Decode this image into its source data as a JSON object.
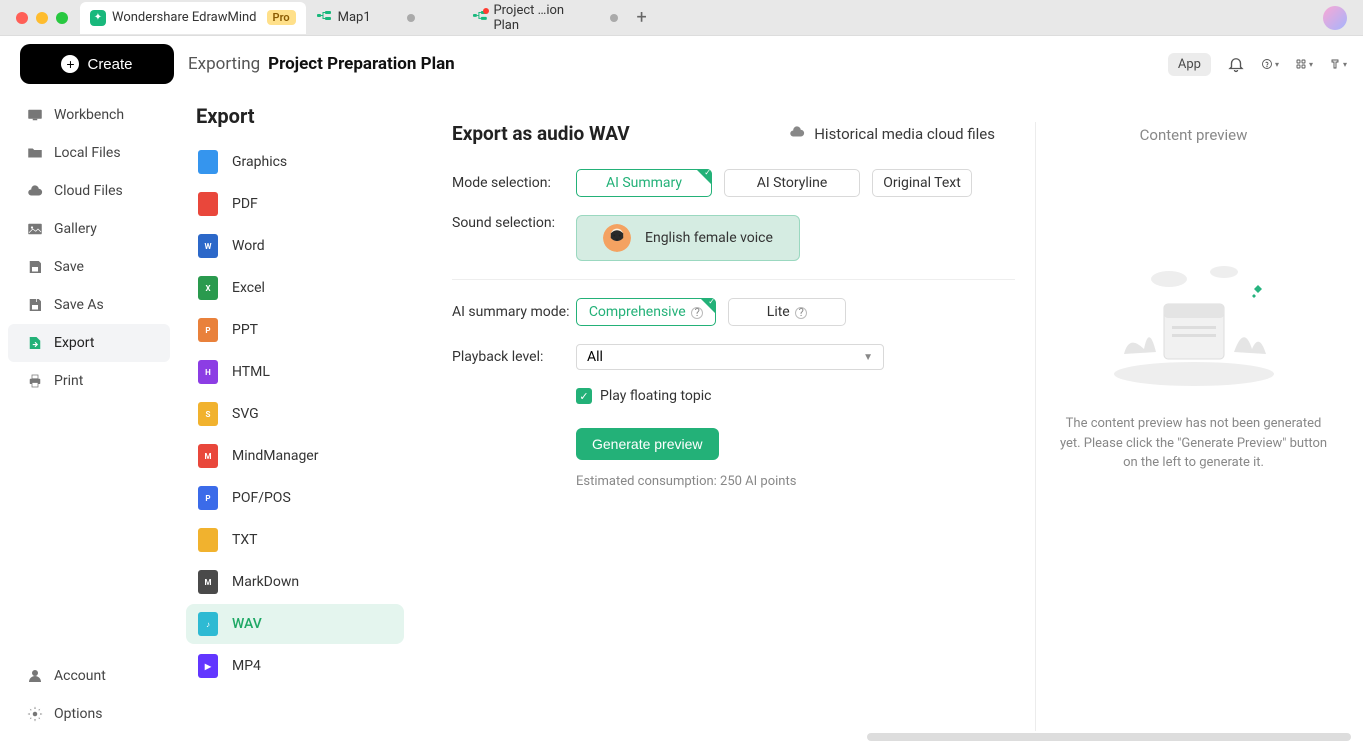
{
  "titlebar": {
    "app_name": "Wondershare EdrawMind",
    "pro_label": "Pro",
    "tabs": [
      {
        "label": "Map1"
      },
      {
        "label": "Project …ion Plan"
      }
    ]
  },
  "header": {
    "create_label": "Create",
    "breadcrumb_exporting": "Exporting",
    "breadcrumb_title": "Project Preparation Plan",
    "app_btn": "App"
  },
  "left_nav": {
    "items": [
      {
        "label": "Workbench",
        "icon": "workbench"
      },
      {
        "label": "Local Files",
        "icon": "folder"
      },
      {
        "label": "Cloud Files",
        "icon": "cloud"
      },
      {
        "label": "Gallery",
        "icon": "gallery"
      },
      {
        "label": "Save",
        "icon": "save"
      },
      {
        "label": "Save As",
        "icon": "save-as"
      },
      {
        "label": "Export",
        "icon": "export",
        "active": true
      },
      {
        "label": "Print",
        "icon": "print"
      }
    ],
    "bottom": [
      {
        "label": "Account",
        "icon": "account"
      },
      {
        "label": "Options",
        "icon": "gear"
      }
    ]
  },
  "export_panel": {
    "title": "Export",
    "formats": [
      {
        "label": "Graphics"
      },
      {
        "label": "PDF"
      },
      {
        "label": "Word"
      },
      {
        "label": "Excel"
      },
      {
        "label": "PPT"
      },
      {
        "label": "HTML"
      },
      {
        "label": "SVG"
      },
      {
        "label": "MindManager"
      },
      {
        "label": "POF/POS"
      },
      {
        "label": "TXT"
      },
      {
        "label": "MarkDown"
      },
      {
        "label": "WAV",
        "active": true
      },
      {
        "label": "MP4"
      }
    ]
  },
  "form": {
    "title": "Export as audio WAV",
    "cloud_link": "Historical media cloud files",
    "mode_label": "Mode selection:",
    "modes": [
      {
        "label": "AI Summary",
        "selected": true
      },
      {
        "label": "AI Storyline"
      },
      {
        "label": "Original Text"
      }
    ],
    "sound_label": "Sound selection:",
    "voice_label": "English female voice",
    "ai_mode_label": "AI summary mode:",
    "ai_modes": [
      {
        "label": "Comprehensive",
        "selected": true
      },
      {
        "label": "Lite"
      }
    ],
    "playback_label": "Playback level:",
    "playback_value": "All",
    "floating_label": "Play floating topic",
    "generate_btn": "Generate preview",
    "estimate": "Estimated consumption: 250 AI points"
  },
  "preview": {
    "title": "Content preview",
    "message": "The content preview has not been generated yet. Please click the \"Generate Preview\" button on the left to generate it."
  }
}
